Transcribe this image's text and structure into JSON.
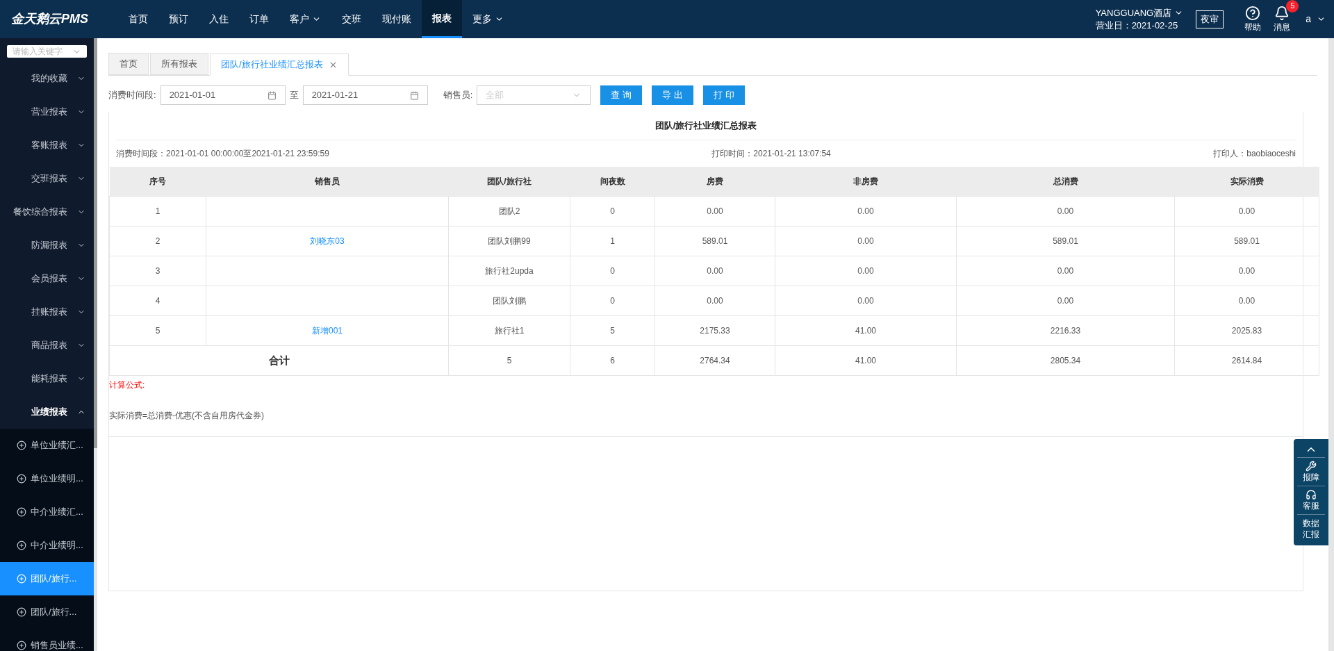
{
  "header": {
    "logo": "金天鹅云PMS",
    "nav": [
      {
        "label": "首页",
        "selected": false,
        "dropdown": false
      },
      {
        "label": "预订",
        "selected": false,
        "dropdown": false
      },
      {
        "label": "入住",
        "selected": false,
        "dropdown": false
      },
      {
        "label": "订单",
        "selected": false,
        "dropdown": false
      },
      {
        "label": "客户",
        "selected": false,
        "dropdown": true
      },
      {
        "label": "交班",
        "selected": false,
        "dropdown": false
      },
      {
        "label": "现付账",
        "selected": false,
        "dropdown": false
      },
      {
        "label": "报表",
        "selected": true,
        "dropdown": false
      },
      {
        "label": "更多",
        "selected": false,
        "dropdown": true
      }
    ],
    "hotel": "YANGGUANG酒店",
    "business_date": "营业日：2021-02-25",
    "night_audit": "夜审",
    "help": "帮助",
    "messages": "消息",
    "message_count": "5",
    "user": "a"
  },
  "sidebar": {
    "search": {
      "placeholder": "请输入关键字"
    },
    "groups": [
      {
        "label": "我的收藏",
        "expanded": false
      },
      {
        "label": "营业报表",
        "expanded": false
      },
      {
        "label": "客账报表",
        "expanded": false
      },
      {
        "label": "交班报表",
        "expanded": false
      },
      {
        "label": "餐饮综合报表",
        "expanded": false
      },
      {
        "label": "防漏报表",
        "expanded": false
      },
      {
        "label": "会员报表",
        "expanded": false
      },
      {
        "label": "挂账报表",
        "expanded": false
      },
      {
        "label": "商品报表",
        "expanded": false
      },
      {
        "label": "能耗报表",
        "expanded": false
      },
      {
        "label": "业绩报表",
        "expanded": true,
        "children": [
          {
            "label": "单位业绩汇...",
            "selected": false
          },
          {
            "label": "单位业绩明...",
            "selected": false
          },
          {
            "label": "中介业绩汇...",
            "selected": false
          },
          {
            "label": "中介业绩明...",
            "selected": false
          },
          {
            "label": "团队/旅行...",
            "selected": true
          },
          {
            "label": "团队/旅行...",
            "selected": false
          },
          {
            "label": "销售员业绩...",
            "selected": false
          }
        ]
      }
    ]
  },
  "tabs": [
    {
      "label": "首页",
      "selected": false,
      "closable": false
    },
    {
      "label": "所有报表",
      "selected": false,
      "closable": false
    },
    {
      "label": "团队/旅行社业绩汇总报表",
      "selected": true,
      "closable": true
    }
  ],
  "filters": {
    "period_label": "消费时间段:",
    "start": "2021-01-01",
    "to": "至",
    "end": "2021-01-21",
    "salesperson_label": "销售员:",
    "salesperson": {
      "placeholder": "全部"
    },
    "buttons": [
      "查 询",
      "导 出",
      "打 印"
    ]
  },
  "report": {
    "title": "团队/旅行社业绩汇总报表",
    "period": "消费时间段：2021-01-01 00:00:00至2021-01-21 23:59:59",
    "print_time": "打印时间：2021-01-21 13:07:54",
    "printer": "打印人：baobiaoceshi",
    "columns": [
      "序号",
      "销售员",
      "团队/旅行社",
      "间夜数",
      "房费",
      "非房费",
      "总消费",
      "实际消费"
    ],
    "rows": [
      [
        "1",
        "",
        "团队2",
        "0",
        "0.00",
        "0.00",
        "0.00",
        "0.00"
      ],
      [
        "2",
        "刘晓东03",
        "团队刘鹏99",
        "1",
        "589.01",
        "0.00",
        "589.01",
        "589.01"
      ],
      [
        "3",
        "",
        "旅行社2upda",
        "0",
        "0.00",
        "0.00",
        "0.00",
        "0.00"
      ],
      [
        "4",
        "",
        "团队刘鹏",
        "0",
        "0.00",
        "0.00",
        "0.00",
        "0.00"
      ],
      [
        "5",
        "新增001",
        "旅行社1",
        "5",
        "2175.33",
        "41.00",
        "2216.33",
        "2025.83"
      ]
    ],
    "total": [
      "合计",
      "5",
      "6",
      "2764.34",
      "41.00",
      "2805.34",
      "2614.84"
    ],
    "formula_title": "计算公式:",
    "formula": "实际消费=总消费-优惠(不含自用房代金券)"
  },
  "float_panel": {
    "items": [
      {
        "kind": "report",
        "label": "报障"
      },
      {
        "kind": "service",
        "label": "客服"
      },
      {
        "kind": "data",
        "label": "数据汇报"
      }
    ]
  }
}
